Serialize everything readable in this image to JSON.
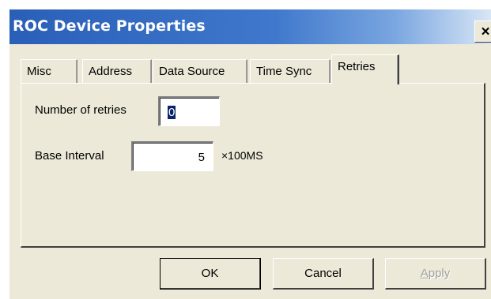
{
  "window": {
    "title": "ROC Device Properties",
    "close_glyph": "×"
  },
  "tabs": [
    {
      "label": "Misc",
      "active": false
    },
    {
      "label": "Address",
      "active": false
    },
    {
      "label": "Data Source",
      "active": false
    },
    {
      "label": "Time Sync",
      "active": false
    },
    {
      "label": "Retries",
      "active": true
    }
  ],
  "retries_panel": {
    "number_of_retries_label": "Number of retries",
    "number_of_retries_value": "0",
    "base_interval_label": "Base Interval",
    "base_interval_value": "5",
    "base_interval_unit": "×100MS"
  },
  "buttons": {
    "ok_label": "OK",
    "cancel_label": "Cancel",
    "apply_label": "Apply",
    "apply_enabled": false
  },
  "colors": {
    "title_bar_start": "#2a5fb8",
    "title_bar_end": "#d8e6f6",
    "dialog_face": "#ece9d8",
    "selection": "#0a246a"
  }
}
